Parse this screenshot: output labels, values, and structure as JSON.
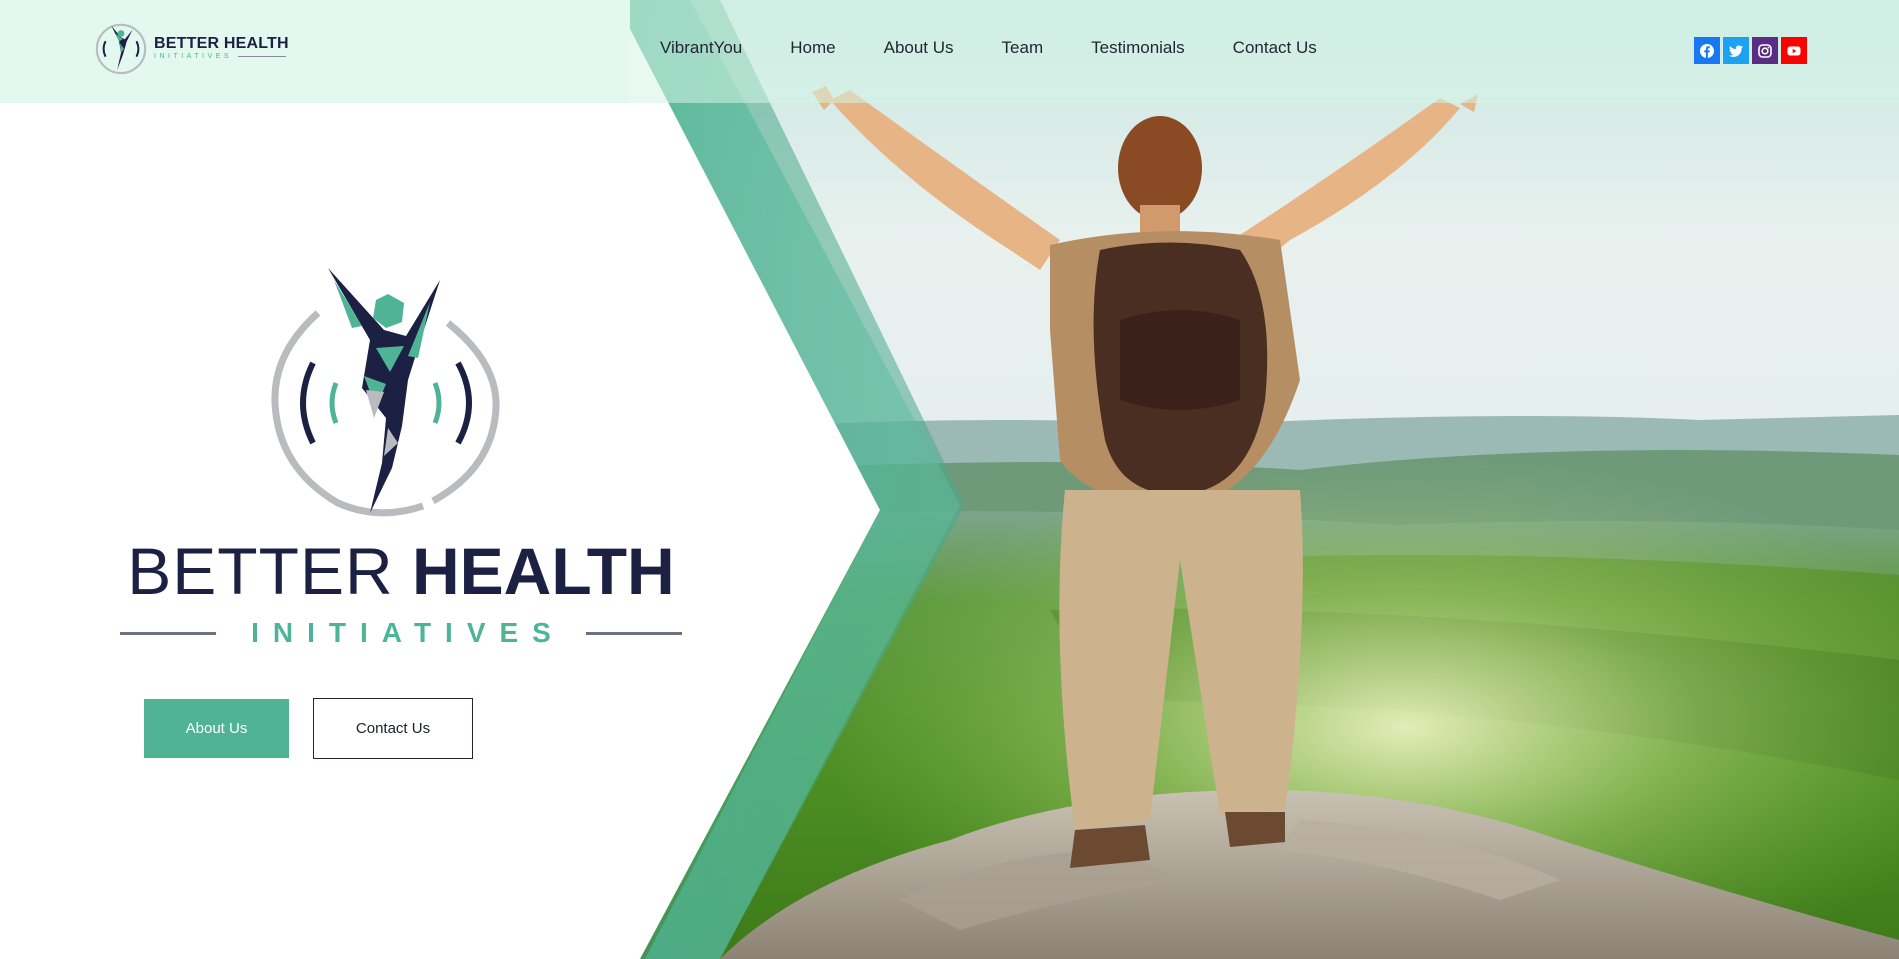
{
  "brand": {
    "name_line1": "BETTER HEALTH",
    "name_line2": "INITIATIVES",
    "title_thin": "BETTER",
    "title_bold": "HEALTH",
    "subtitle": "INITIATIVES",
    "colors": {
      "navy": "#1c2043",
      "teal": "#4fb395",
      "gray": "#b9bbbf"
    }
  },
  "nav": {
    "items": [
      {
        "label": "VibrantYou"
      },
      {
        "label": "Home"
      },
      {
        "label": "About Us"
      },
      {
        "label": "Team"
      },
      {
        "label": "Testimonials"
      },
      {
        "label": "Contact Us"
      }
    ]
  },
  "socials": [
    {
      "icon": "facebook-icon",
      "color": "#1877f2"
    },
    {
      "icon": "twitter-icon",
      "color": "#1da1f2"
    },
    {
      "icon": "instagram-icon",
      "color": "#5b2c83"
    },
    {
      "icon": "youtube-icon",
      "color": "#ff0000"
    }
  ],
  "hero": {
    "image": "hiker with arms raised on a rocky summit overlooking green valley",
    "buttons": {
      "primary_label": "About Us",
      "secondary_label": "Contact Us"
    }
  }
}
